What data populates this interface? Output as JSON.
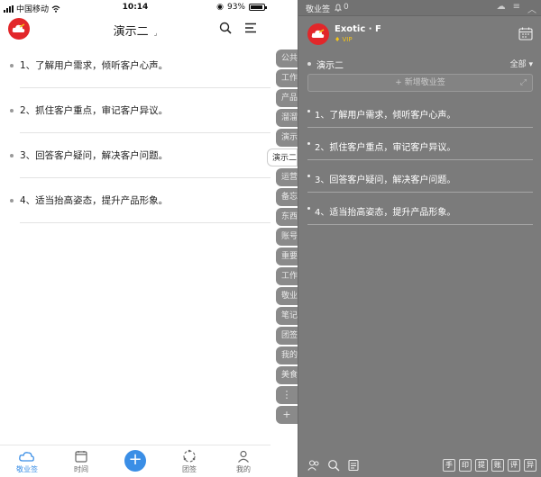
{
  "phone": {
    "status": {
      "carrier": "中国移动",
      "time": "10:14",
      "battery": "93%",
      "battery_level": 0.93
    },
    "header": {
      "title": "演示二",
      "caret": "⌟"
    },
    "notes": [
      "1、了解用户需求，倾听客户心声。",
      "2、抓住客户重点，审记客户异议。",
      "3、回答客户疑问，解决客户问题。",
      "4、适当抬高姿态，提升产品形象。"
    ],
    "tabs": [
      {
        "label": "敬业签"
      },
      {
        "label": "时间"
      },
      {
        "label": ""
      },
      {
        "label": "团签"
      },
      {
        "label": "我的"
      }
    ]
  },
  "tags": [
    "公共",
    "工作",
    "产品",
    "溜溜",
    "演示",
    "演示二",
    "运营",
    "备忘",
    "东西",
    "账号",
    "重要",
    "工作",
    "敬业",
    "笔记",
    "团签",
    "我的",
    "美食"
  ],
  "tag_active_index": 5,
  "tag_tools": [
    "⋮",
    "+"
  ],
  "widget": {
    "title": "敬业签",
    "notify_count": "0",
    "user": {
      "name": "Exotic · F",
      "vip": "VIP"
    },
    "filter": {
      "name": "演示二",
      "all": "全部 ▾"
    },
    "new_placeholder": "+ 新增敬业签",
    "notes": [
      "1、了解用户需求，倾听客户心声。",
      "2、抓住客户重点，审记客户异议。",
      "3、回答客户疑问，解决客户问题。",
      "4、适当抬高姿态，提升产品形象。"
    ],
    "footer_buttons": [
      "手",
      "印",
      "提",
      "账",
      "评",
      "异"
    ]
  },
  "colors": {
    "accent": "#3a8ee6",
    "brand": "#e2272a",
    "widget_bg": "#7b7b7b"
  }
}
